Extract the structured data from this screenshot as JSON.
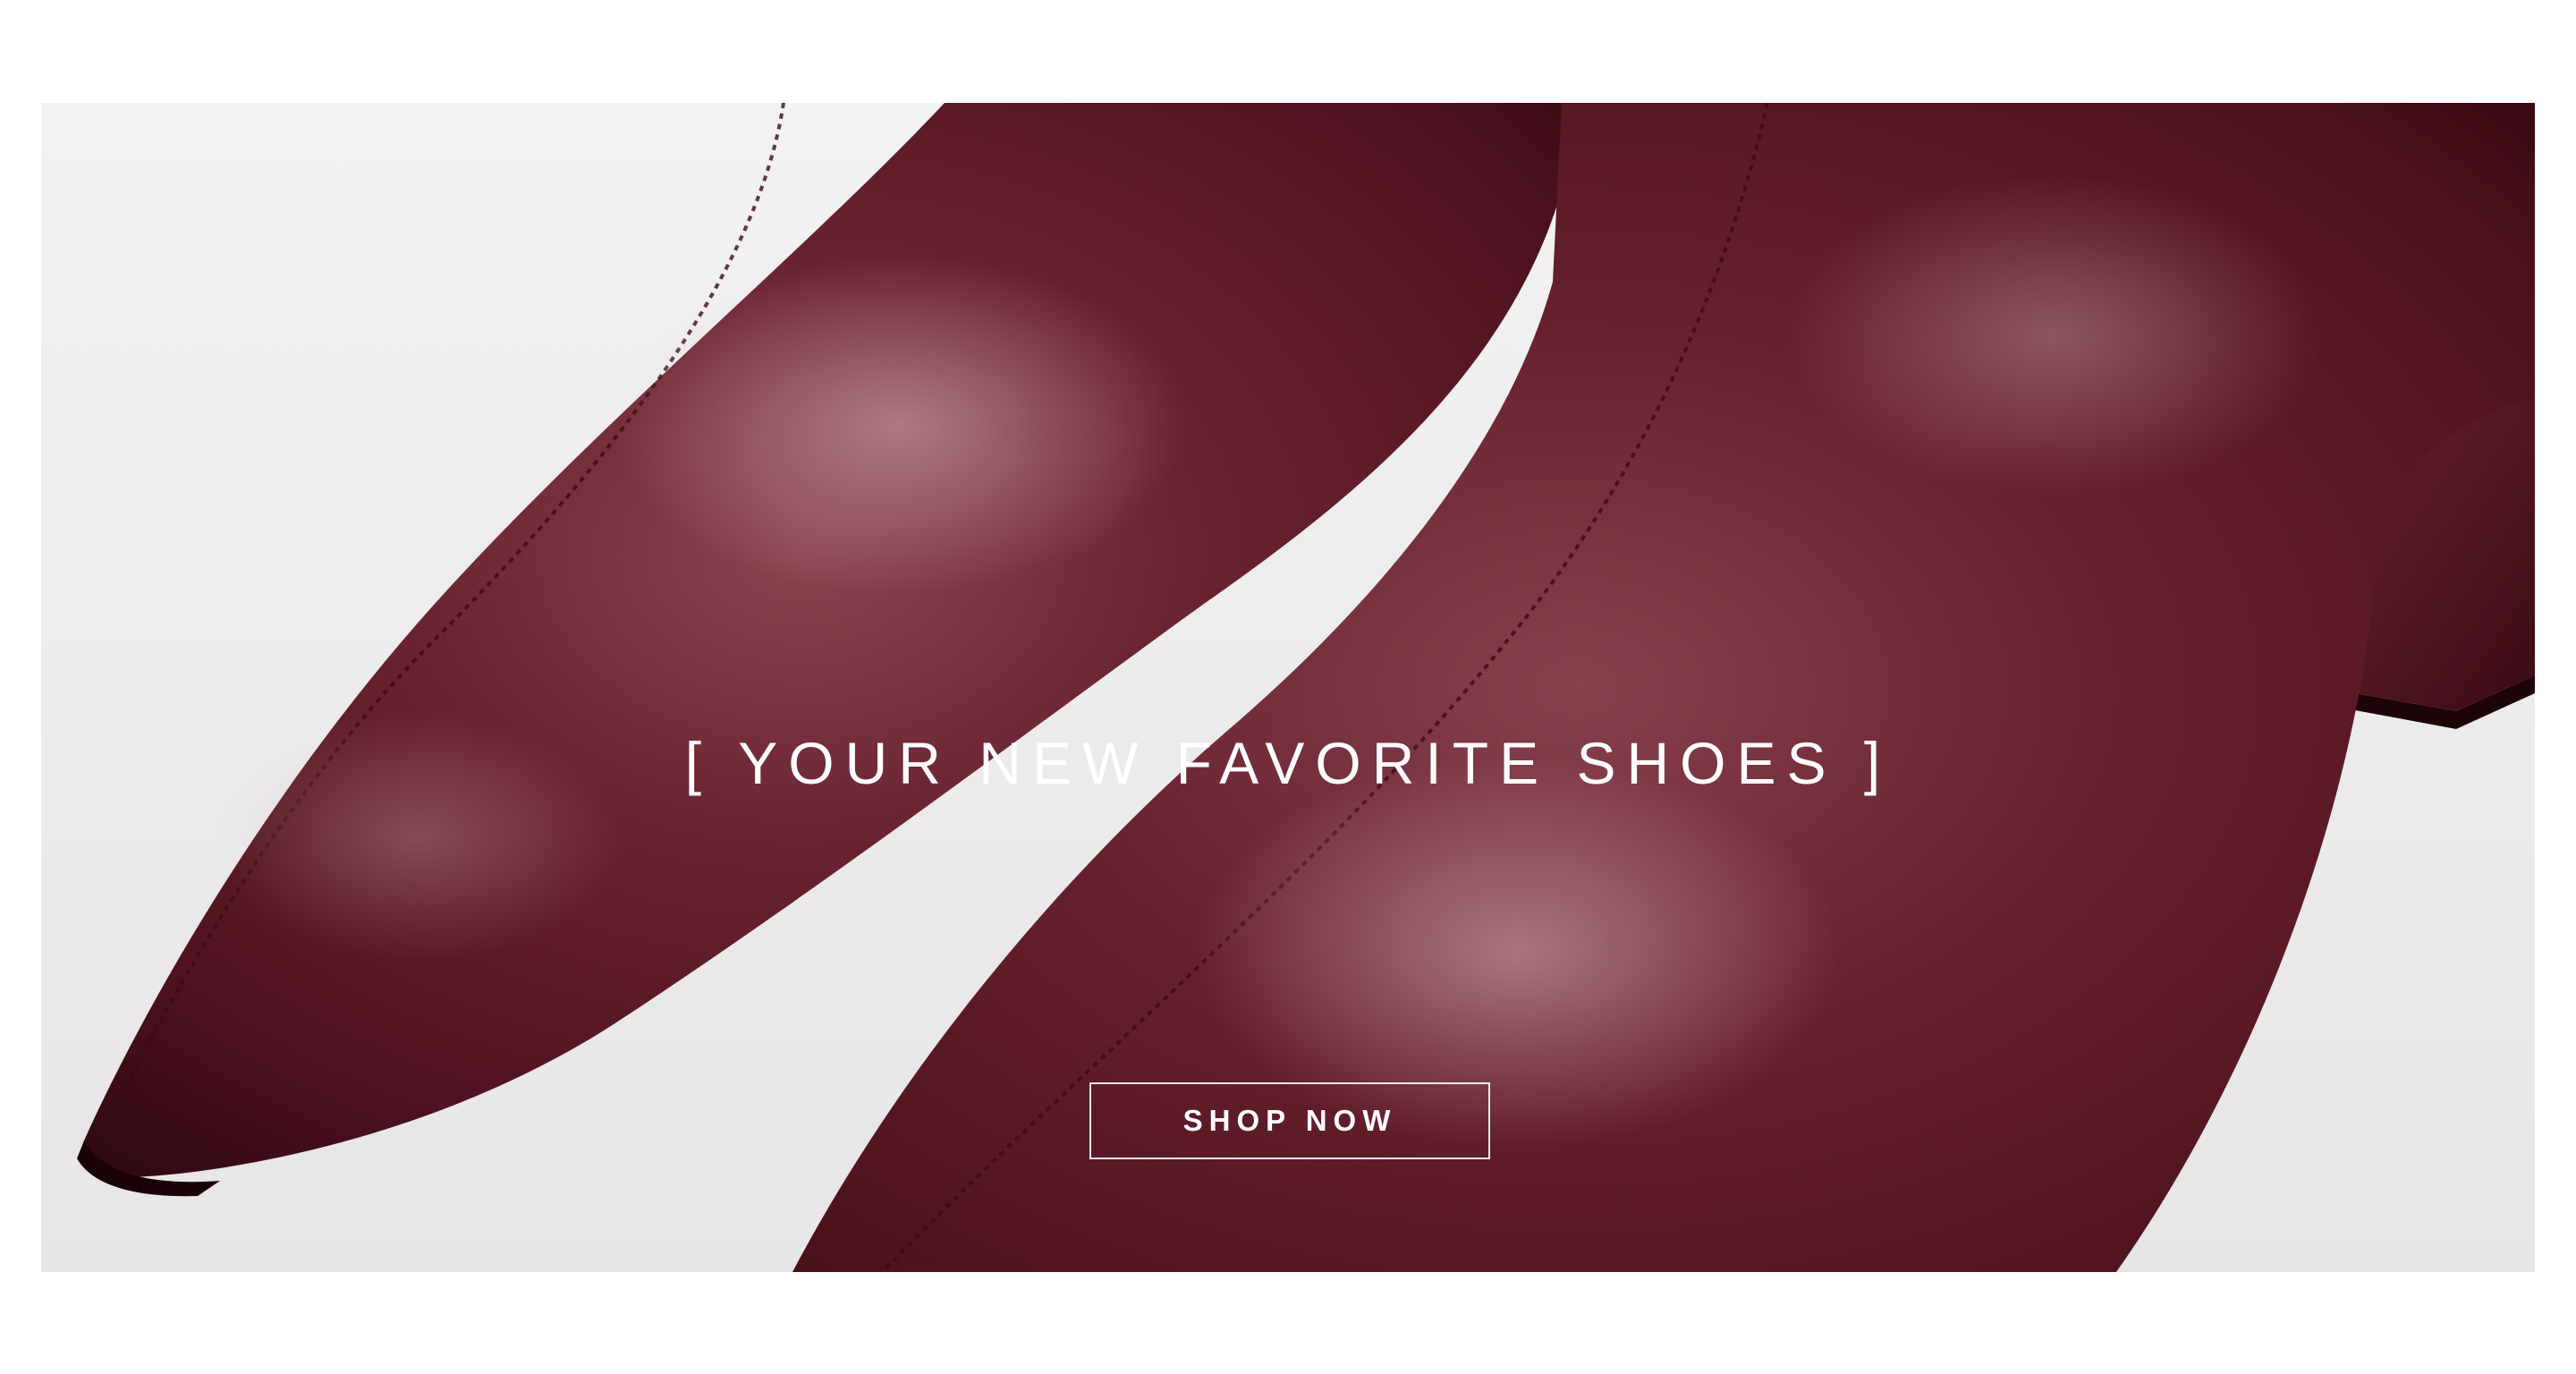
{
  "hero": {
    "headline": "[ YOUR NEW FAVORITE SHOES ]",
    "cta_label": "SHOP NOW",
    "image_subject": "burgundy-leather-pointed-ankle-boots"
  },
  "colors": {
    "page_background": "#ffffff",
    "backdrop": "#efeeee",
    "leather": "#5a1520",
    "text": "#ffffff"
  }
}
